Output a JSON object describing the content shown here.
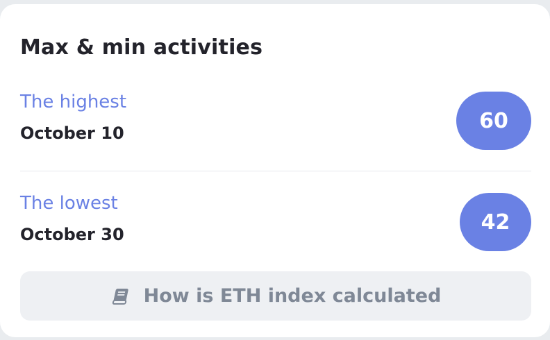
{
  "card": {
    "title": "Max & min activities"
  },
  "highest": {
    "label": "The highest",
    "date": "October 10",
    "value": "60"
  },
  "lowest": {
    "label": "The lowest",
    "date": "October 30",
    "value": "42"
  },
  "info": {
    "icon": "book-icon",
    "label": "How is ETH index calculated"
  },
  "colors": {
    "accent": "#6a81e4",
    "text_dark": "#23232b",
    "button_bg": "#eef0f3",
    "button_text": "#7f8896"
  }
}
